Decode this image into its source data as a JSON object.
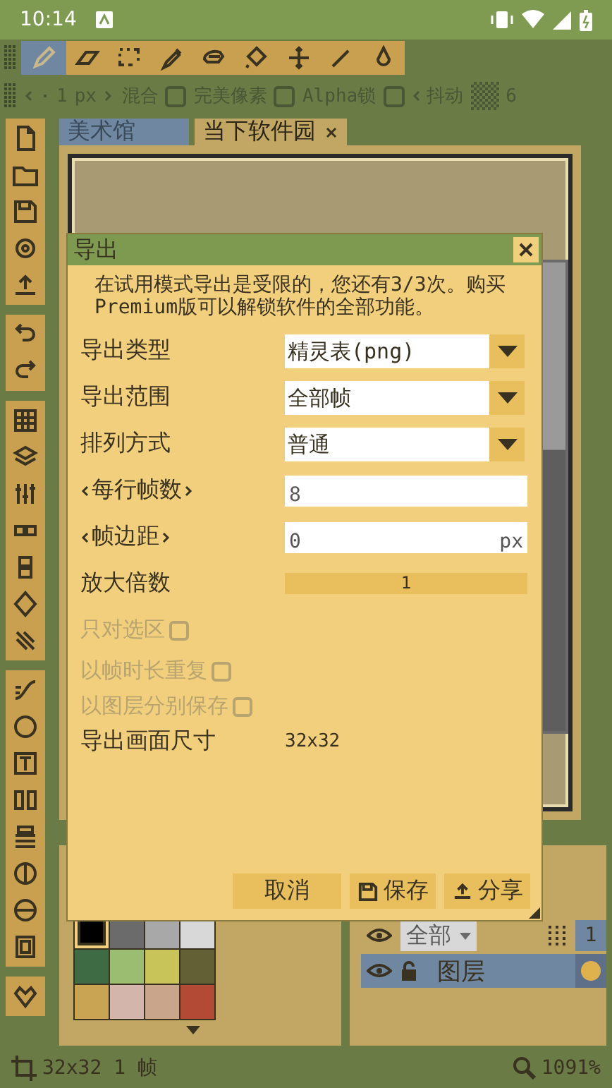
{
  "status_bar": {
    "time": "10:14"
  },
  "toolbar": {
    "tools": [
      {
        "selected": true
      },
      {
        "selected": false
      },
      {
        "selected": false
      },
      {
        "selected": false
      },
      {
        "selected": false
      },
      {
        "selected": false
      },
      {
        "selected": false
      },
      {
        "selected": false
      },
      {
        "selected": false
      }
    ]
  },
  "options": {
    "size": "1",
    "unit": "px",
    "checks": [
      {
        "label": "混合",
        "checked": false
      },
      {
        "label": "完美像素",
        "checked": false
      },
      {
        "label": "Alpha锁",
        "checked": false
      }
    ],
    "dither_label": "抖动",
    "dither_value": "6"
  },
  "tabs": [
    {
      "label": "美术馆",
      "selected": false,
      "closable": false
    },
    {
      "label": "当下软件园",
      "selected": true,
      "closable": true
    }
  ],
  "dialog": {
    "title": "导出",
    "message": "在试用模式导出是受限的，您还有3/3次。购买Premium版可以解锁软件的全部功能。",
    "fields": [
      {
        "kind": "dropdown",
        "label": "导出类型",
        "value": "精灵表(png)"
      },
      {
        "kind": "dropdown",
        "label": "导出范围",
        "value": "全部帧"
      },
      {
        "kind": "dropdown",
        "label": "排列方式",
        "value": "普通"
      },
      {
        "kind": "stepper",
        "label": "每行帧数",
        "value": "8"
      },
      {
        "kind": "stepper",
        "label": "帧边距",
        "value": "0",
        "unit": "px"
      },
      {
        "kind": "numberbar",
        "label": "放大倍数",
        "value": "1",
        "level": 1
      },
      {
        "kind": "checkbox",
        "label": "只对选区",
        "checked": false,
        "disabled": true
      },
      {
        "kind": "checkbox",
        "label": "以帧时长重复",
        "checked": false,
        "disabled": true
      },
      {
        "kind": "checkbox",
        "label": "以图层分别保存",
        "checked": false,
        "disabled": true
      },
      {
        "kind": "info",
        "label": "导出画面尺寸",
        "value": "32x32"
      }
    ],
    "buttons": [
      {
        "label": "取消"
      },
      {
        "label": "保存"
      },
      {
        "label": "分享"
      }
    ]
  },
  "palette": {
    "colors": [
      {
        "color": "#000000",
        "selected": true
      },
      {
        "color": "#6b6b6b",
        "selected": false
      },
      {
        "color": "#a8a8a8",
        "selected": false
      },
      {
        "color": "#d8d8d8",
        "selected": false
      },
      {
        "color": "#3e6b44",
        "selected": false
      },
      {
        "color": "#9bbd72",
        "selected": false
      },
      {
        "color": "#c9c45a",
        "selected": false
      },
      {
        "color": "#626034",
        "selected": false
      },
      {
        "color": "#c9a553",
        "selected": false
      },
      {
        "color": "#d4b5ac",
        "selected": false
      },
      {
        "color": "#c9a68b",
        "selected": false
      },
      {
        "color": "#b34a36",
        "selected": false
      }
    ]
  },
  "layers": {
    "filter": "全部",
    "frame": "1",
    "rows": [
      {
        "name": "图层",
        "selected": true
      }
    ]
  },
  "bottom_bar": {
    "size": "32x32 1 帧",
    "zoom": "1091%"
  }
}
